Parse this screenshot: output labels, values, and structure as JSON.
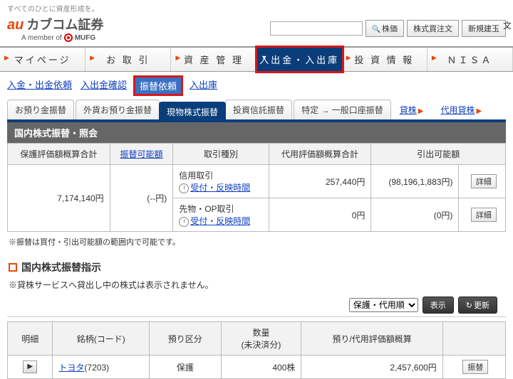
{
  "tagline": "すべてのひとに資産形成を。",
  "logo": {
    "au": "au",
    "brand": "カブコム証券",
    "member": "A member of",
    "mufg": "MUFG"
  },
  "header": {
    "btn_price": "株価",
    "btn_buy": "株式買注文",
    "btn_new": "新規建玉",
    "trail": "文"
  },
  "main_tabs": [
    "マイページ",
    "お 取 引",
    "資 産 管 理",
    "入出金・入出庫",
    "投 資 情 報",
    "ＮＩＳＡ"
  ],
  "subnav": {
    "a": "入金・出金依頼",
    "b": "入出金確認",
    "c": "振替依頼",
    "d": "入出庫"
  },
  "tabs": {
    "t1": "お預り金振替",
    "t2": "外貨お預り金振替",
    "t3": "現物株式振替",
    "t4": "投資信託振替",
    "t5": "特定 → 一般口座振替",
    "t6": "貸株",
    "t7": "代用貸株"
  },
  "section1_title": "国内株式振替・照会",
  "table1": {
    "h1": "保護評価額概算合計",
    "h2": "振替可能額",
    "h3": "取引種別",
    "h4": "代用評価額概算合計",
    "h5": "引出可能額",
    "r1_val": "7,174,140円",
    "r1_kanou": "(--円)",
    "shinyou": "信用取引",
    "time_link": "受付・反映時間",
    "daiyou_val": "257,440円",
    "hikidashi1": "(98,196,1,883円)",
    "detail": "詳細",
    "sakimono": "先物・OP取引",
    "sakimono_val": "0円",
    "hikidashi2": "(0円)"
  },
  "note1": "※振替は買付・引出可能額の範囲内で可能です。",
  "section2_title": "国内株式振替指示",
  "note2": "※貸株サービスへ貸出し中の株式は表示されません。",
  "dropdown": "保護・代用順",
  "btn_show": "表示",
  "btn_refresh": "更新",
  "table2": {
    "h1": "明細",
    "h2": "銘柄(コード)",
    "h3": "預り区分",
    "h4_a": "数量",
    "h4_b": "(未決済分)",
    "h5": "預り/代用評価額概算",
    "stock": "トヨタ",
    "code": "(7203)",
    "azukari": "保護",
    "qty": "400株",
    "val": "2,457,600円",
    "btn": "振替"
  }
}
